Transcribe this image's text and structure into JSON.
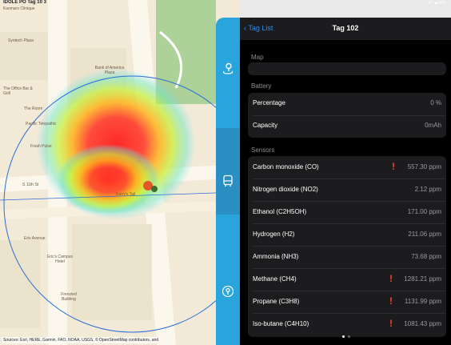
{
  "statusbar": {
    "left": "IDOLE PO Tag 10 3",
    "right": "67 ◀ 45%"
  },
  "map": {
    "labels": [
      "Kasmaro Clinique",
      "Syntech Plaza",
      "Bank of America Plaza",
      "The Office Bar & Grill",
      "The Room",
      "Pacific Telepathic",
      "Fresh Pulse",
      "S 11th St",
      "Eris Avenue",
      "Eric's Campus Hotel",
      "Frenzied Building",
      "Kerry's Tail"
    ],
    "source": "Sources: Esri, HERE, Garmin, FAO, NOAA, USGS, © OpenStreetMap contributors, and"
  },
  "sidebar": {
    "icons": [
      "map-pin-icon",
      "bus-icon",
      "probe-icon"
    ]
  },
  "nav": {
    "back": "Tag List",
    "title": "Tag 102"
  },
  "sections": {
    "map": {
      "header": "Map"
    },
    "battery": {
      "header": "Battery",
      "rows": [
        {
          "label": "Percentage",
          "value": "0 %"
        },
        {
          "label": "Capacity",
          "value": "0mAh"
        }
      ]
    },
    "sensors": {
      "header": "Sensors",
      "rows": [
        {
          "label": "Carbon monoxide (CO)",
          "value": "557.30 ppm",
          "warn": "!"
        },
        {
          "label": "Nitrogen dioxide (NO2)",
          "value": "2.12 ppm"
        },
        {
          "label": "Ethanol (C2H5OH)",
          "value": "171.00 ppm"
        },
        {
          "label": "Hydrogen (H2)",
          "value": "211.06 ppm"
        },
        {
          "label": "Ammonia (NH3)",
          "value": "73.68 ppm"
        },
        {
          "label": "Methane (CH4)",
          "value": "1281.21 ppm",
          "warn": "!"
        },
        {
          "label": "Propane (C3H8)",
          "value": "1131.99 ppm",
          "warn": "!"
        },
        {
          "label": "Iso-butane (C4H10)",
          "value": "1081.43 ppm",
          "warn": "!"
        }
      ]
    }
  },
  "colors": {
    "accent": "#2aa4dd",
    "warning": "#ff3b30",
    "link": "#1e90ff"
  }
}
